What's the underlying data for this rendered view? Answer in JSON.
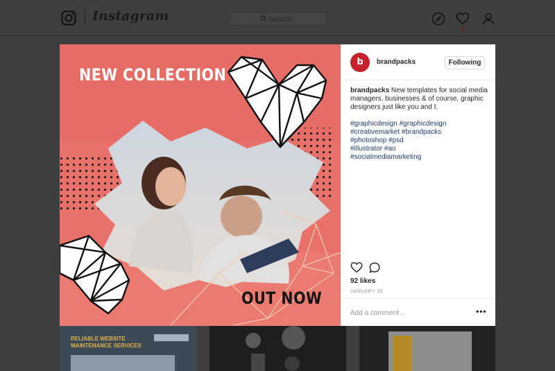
{
  "nav": {
    "logo_icon": "instagram-camera-icon",
    "wordmark": "Instagram",
    "search_placeholder": "Search",
    "icons": [
      "compass-icon",
      "heart-icon",
      "profile-icon"
    ]
  },
  "post": {
    "image": {
      "headline": "NEW COLLECTION",
      "footer": "OUT NOW",
      "accent_color": "#e86d66"
    },
    "author": {
      "avatar_letter": "b",
      "username": "brandpacks",
      "follow_label": "Following",
      "brand_color": "#c7222c"
    },
    "caption": {
      "username": "brandpacks",
      "text": "New templates for social media managers, businesses & of course, graphic designers just like you and I."
    },
    "hashtags": [
      "#graphicdesign #graphicdesign",
      "#creativemarket #brandpacks",
      "#photoshop #psd",
      "#illustrator #ao",
      "#socialmediamarketing"
    ],
    "likes": "92 likes",
    "date": "JANUARY 16",
    "comment_placeholder": "Add a comment...",
    "more_label": "•••"
  },
  "grid": {
    "thumb_a_title": "RELIABLE WEBSITE MAINTENANCE SERVICES"
  }
}
